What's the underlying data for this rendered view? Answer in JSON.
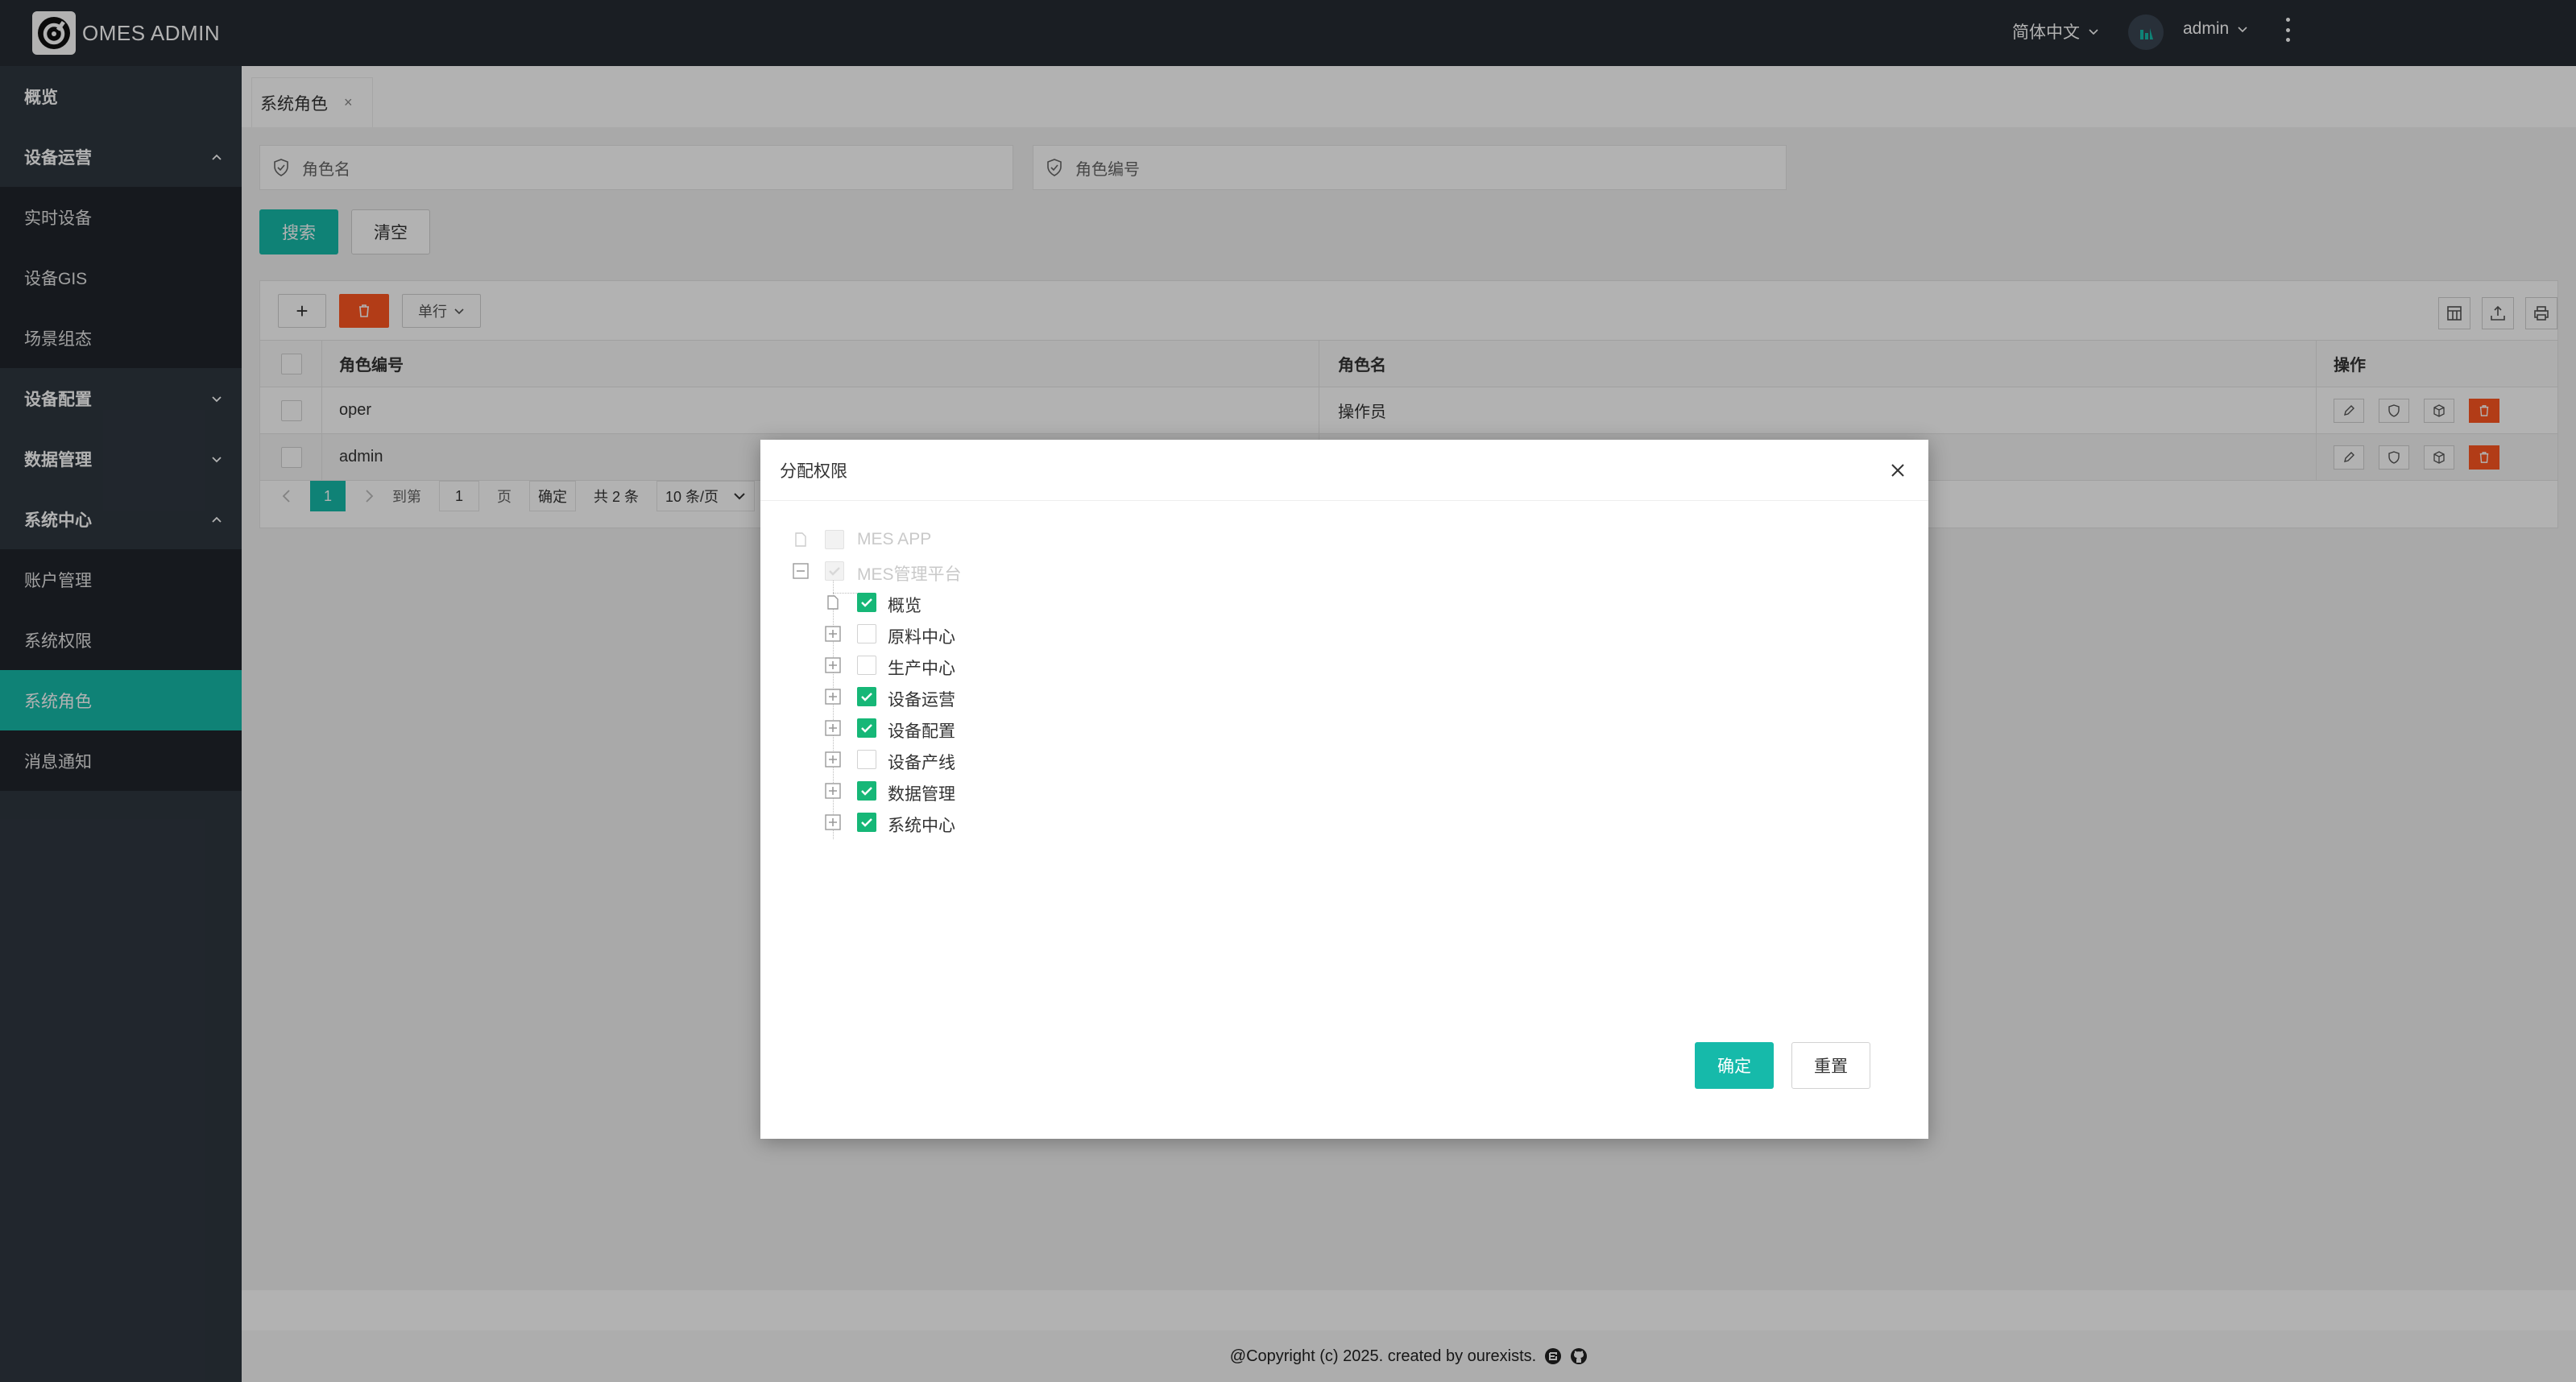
{
  "app": {
    "title": "OMES ADMIN"
  },
  "header": {
    "language": "简体中文",
    "user": "admin"
  },
  "sidebar": {
    "items": [
      {
        "label": "概览",
        "kind": "top"
      },
      {
        "label": "设备运营",
        "kind": "group",
        "expanded": true
      },
      {
        "label": "实时设备",
        "kind": "sub"
      },
      {
        "label": "设备GIS",
        "kind": "sub"
      },
      {
        "label": "场景组态",
        "kind": "sub"
      },
      {
        "label": "设备配置",
        "kind": "group",
        "expanded": false
      },
      {
        "label": "数据管理",
        "kind": "group",
        "expanded": false
      },
      {
        "label": "系统中心",
        "kind": "group",
        "expanded": true
      },
      {
        "label": "账户管理",
        "kind": "sub"
      },
      {
        "label": "系统权限",
        "kind": "sub"
      },
      {
        "label": "系统角色",
        "kind": "sub",
        "active": true
      },
      {
        "label": "消息通知",
        "kind": "sub"
      }
    ]
  },
  "tabs": [
    {
      "label": "系统角色",
      "close": "×"
    }
  ],
  "search": {
    "role_name_placeholder": "角色名",
    "role_code_placeholder": "角色编号",
    "search_label": "搜索",
    "clear_label": "清空"
  },
  "toolbar": {
    "add": "+",
    "row_mode": "单行"
  },
  "table": {
    "headers": {
      "code": "角色编号",
      "name": "角色名",
      "ops": "操作"
    },
    "rows": [
      {
        "code": "oper",
        "name": "操作员"
      },
      {
        "code": "admin",
        "name": ""
      }
    ]
  },
  "pager": {
    "current": "1",
    "goto": "到第",
    "page_input": "1",
    "page_unit": "页",
    "confirm": "确定",
    "total": "共 2 条",
    "per_page": "10 条/页"
  },
  "footer": {
    "text": "@Copyright (c) 2025. created by ourexists."
  },
  "modal": {
    "title": "分配权限",
    "confirm": "确定",
    "reset": "重置",
    "tree": [
      {
        "label": "MES APP",
        "checked": false,
        "disabled": true,
        "level": 0,
        "expander": "leaf"
      },
      {
        "label": "MES管理平台",
        "checked": true,
        "disabled": true,
        "level": 0,
        "expander": "minus"
      },
      {
        "label": "概览",
        "checked": true,
        "level": 1,
        "expander": "leaf"
      },
      {
        "label": "原料中心",
        "checked": false,
        "level": 1,
        "expander": "plus"
      },
      {
        "label": "生产中心",
        "checked": false,
        "level": 1,
        "expander": "plus"
      },
      {
        "label": "设备运营",
        "checked": true,
        "level": 1,
        "expander": "plus"
      },
      {
        "label": "设备配置",
        "checked": true,
        "level": 1,
        "expander": "plus"
      },
      {
        "label": "设备产线",
        "checked": false,
        "level": 1,
        "expander": "plus"
      },
      {
        "label": "数据管理",
        "checked": true,
        "level": 1,
        "expander": "plus"
      },
      {
        "label": "系统中心",
        "checked": true,
        "level": 1,
        "expander": "plus"
      }
    ]
  },
  "colors": {
    "primary": "#16baaa",
    "danger": "#ff5722",
    "check": "#16b777",
    "sidebar": "#2f3740"
  }
}
